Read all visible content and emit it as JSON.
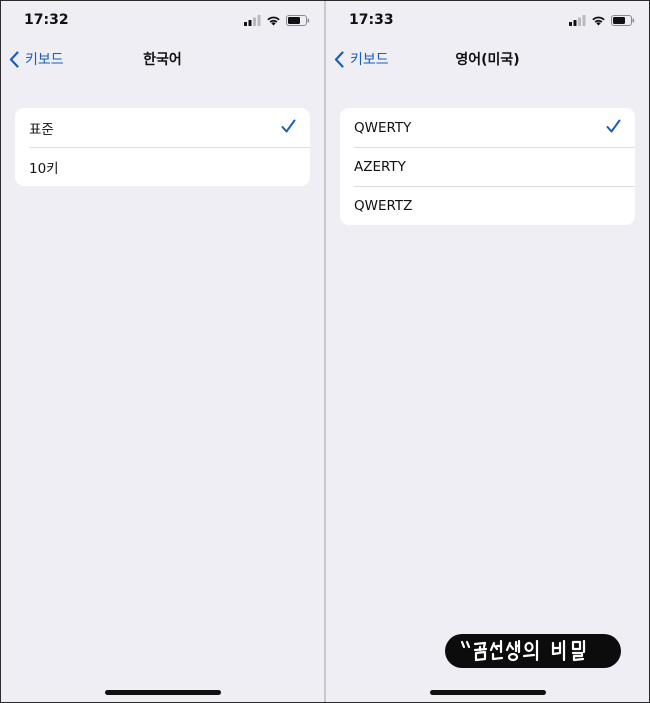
{
  "left_screen": {
    "time": "17:32",
    "back_label": "키보드",
    "title": "한국어",
    "options": [
      {
        "label": "표준",
        "selected": true
      },
      {
        "label": "10키",
        "selected": false
      }
    ]
  },
  "right_screen": {
    "time": "17:33",
    "back_label": "키보드",
    "title": "영어(미국)",
    "options": [
      {
        "label": "QWERTY",
        "selected": true
      },
      {
        "label": "AZERTY",
        "selected": false
      },
      {
        "label": "QWERTZ",
        "selected": false
      }
    ]
  },
  "watermark": {
    "text": "“곰선생의 비밀"
  },
  "colors": {
    "accent": "#1a5fb4",
    "background": "#efeef4",
    "card": "#ffffff"
  },
  "icons": [
    "cellular-signal-icon",
    "wifi-icon",
    "battery-icon",
    "chevron-left-icon",
    "checkmark-icon"
  ]
}
